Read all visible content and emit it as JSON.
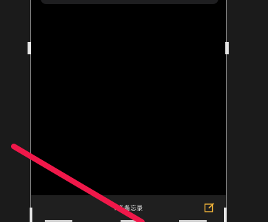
{
  "toolbar": {
    "label": "i 条备忘录",
    "compose_icon": "compose-icon"
  },
  "colors": {
    "accent": "#f2b53a",
    "annotation": "#f0184a",
    "background": "#000000",
    "toolbar": "#1f1f1f"
  }
}
